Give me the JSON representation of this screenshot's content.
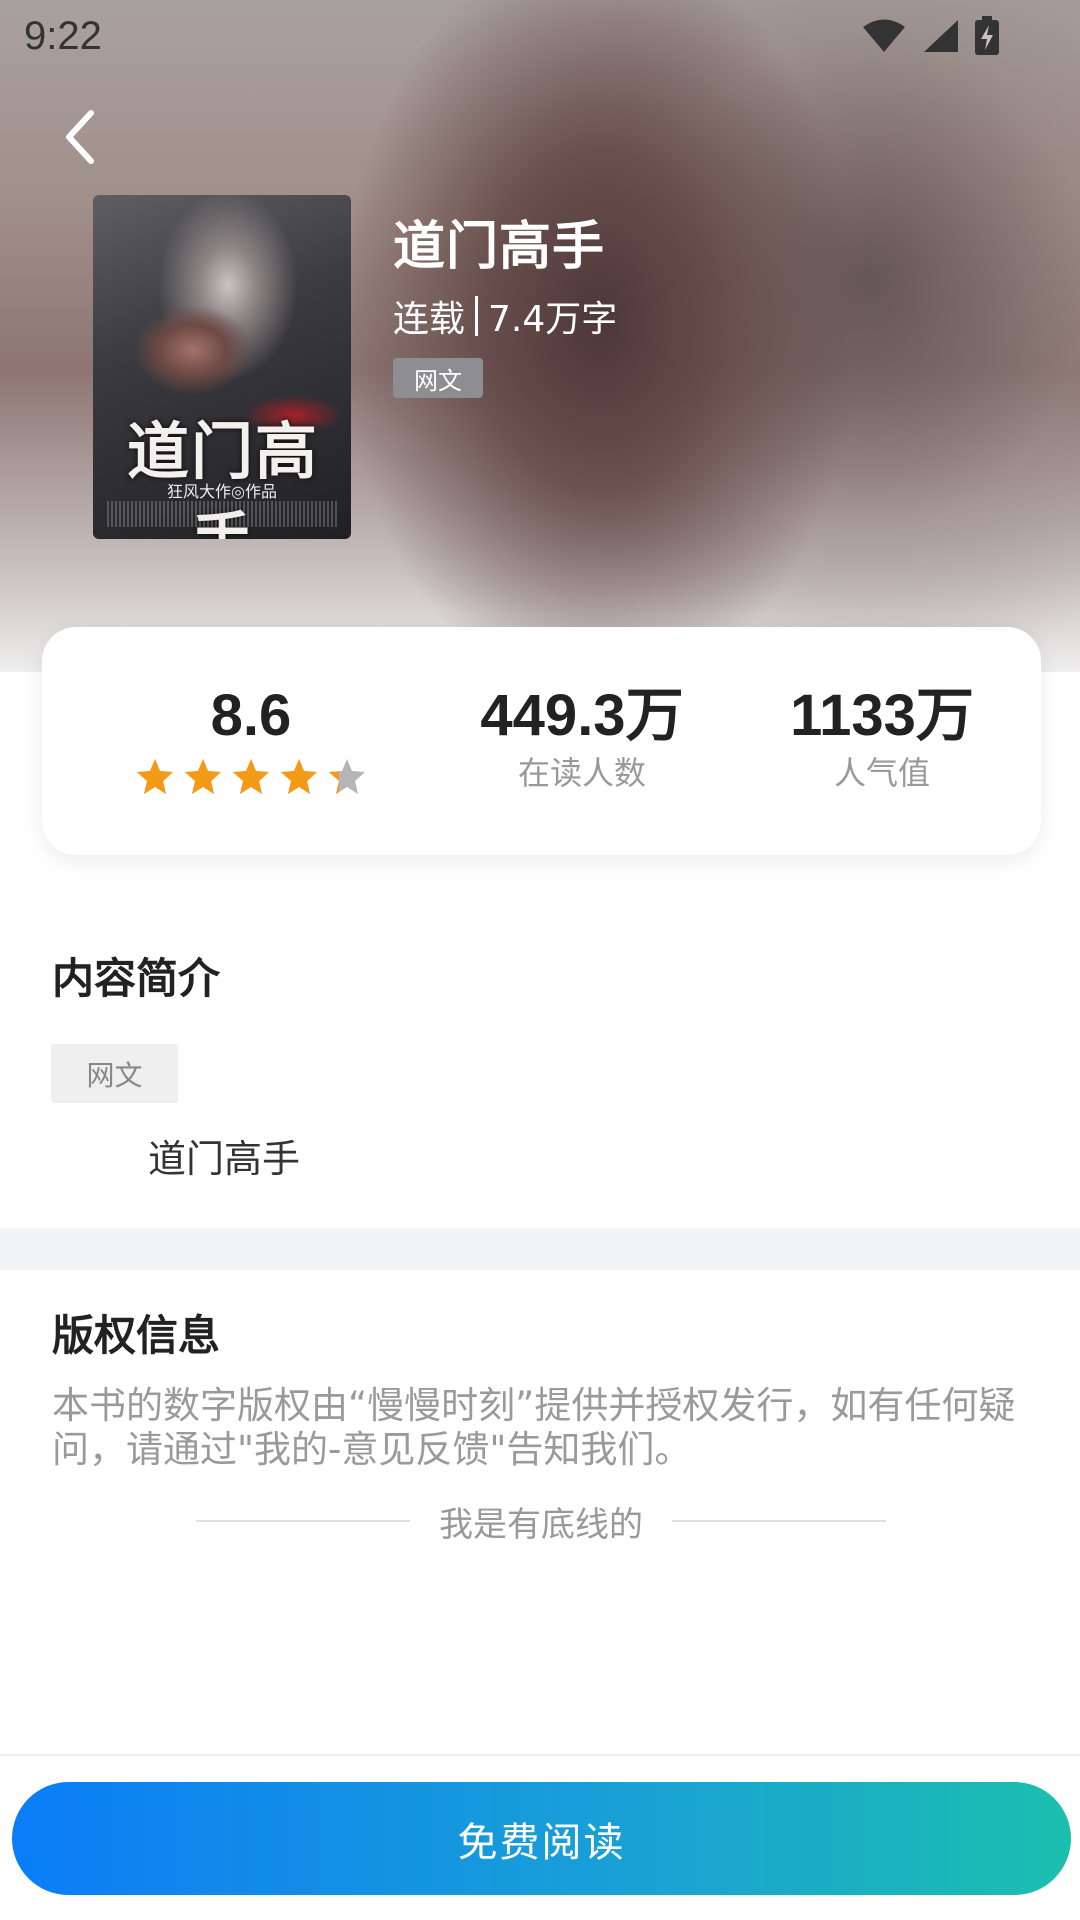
{
  "status_bar": {
    "time": "9:22",
    "icons": [
      "wifi-icon",
      "signal-icon",
      "battery-charging-icon"
    ]
  },
  "header": {
    "back_icon": "chevron-left-icon"
  },
  "book": {
    "title": "道门高手",
    "status": "连载",
    "word_count": "7.4万字",
    "genre_tag": "网文",
    "cover": {
      "title_text": "道门高手",
      "author_text": "狂风大作◎作品"
    }
  },
  "stats": {
    "rating": {
      "value": "8.6",
      "stars_out_of_5": 4.3,
      "star_color_filled": "#f59a16",
      "star_color_empty": "#b5b5b5"
    },
    "readers": {
      "value": "449.3万",
      "label": "在读人数"
    },
    "popularity": {
      "value": "1133万",
      "label": "人气值"
    }
  },
  "intro": {
    "section_title": "内容简介",
    "tag": "网文",
    "text": "道门高手"
  },
  "copyright": {
    "section_title": "版权信息",
    "text": "本书的数字版权由“慢慢时刻”提供并授权发行，如有任何疑问，请通过\"我的-意见反馈\"告知我们。",
    "bottom_line": "我是有底线的"
  },
  "footer": {
    "read_button_label": "免费阅读",
    "button_gradient_start": "#0a7df7",
    "button_gradient_end": "#1bbfae"
  }
}
